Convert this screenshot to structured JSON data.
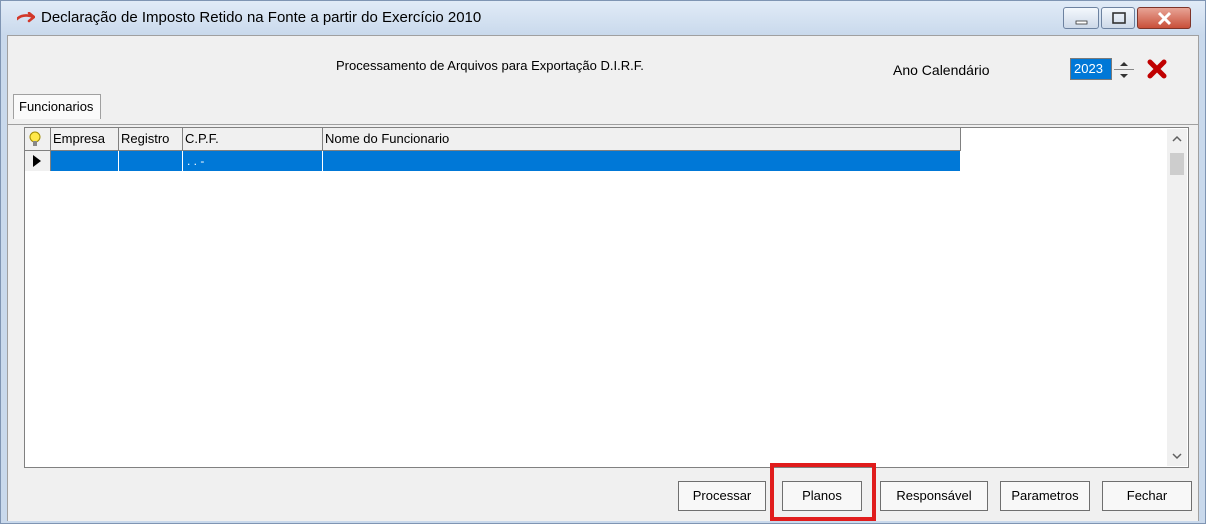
{
  "window": {
    "title": "Declaração de Imposto Retido na Fonte a partir do Exercício 2010",
    "icon": "app-arrow-icon"
  },
  "header": {
    "title": "Processamento de Arquivos para Exportação D.I.R.F.",
    "ano_label": "Ano Calendário",
    "year_value": "2023"
  },
  "tabs": [
    {
      "label": "Funcionarios"
    }
  ],
  "grid": {
    "columns": [
      "Empresa",
      "Registro",
      "C.P.F.",
      "Nome do Funcionario"
    ],
    "rows": [
      {
        "empresa": "",
        "registro": "",
        "cpf": ". . -",
        "nome": ""
      }
    ]
  },
  "buttons": {
    "processar": "Processar",
    "planos": "Planos",
    "responsavel": "Responsável",
    "parametros": "Parametros",
    "fechar": "Fechar"
  },
  "colors": {
    "selection": "#0078d7",
    "highlight_box": "#e01c1c",
    "close_x": "#c00000"
  }
}
